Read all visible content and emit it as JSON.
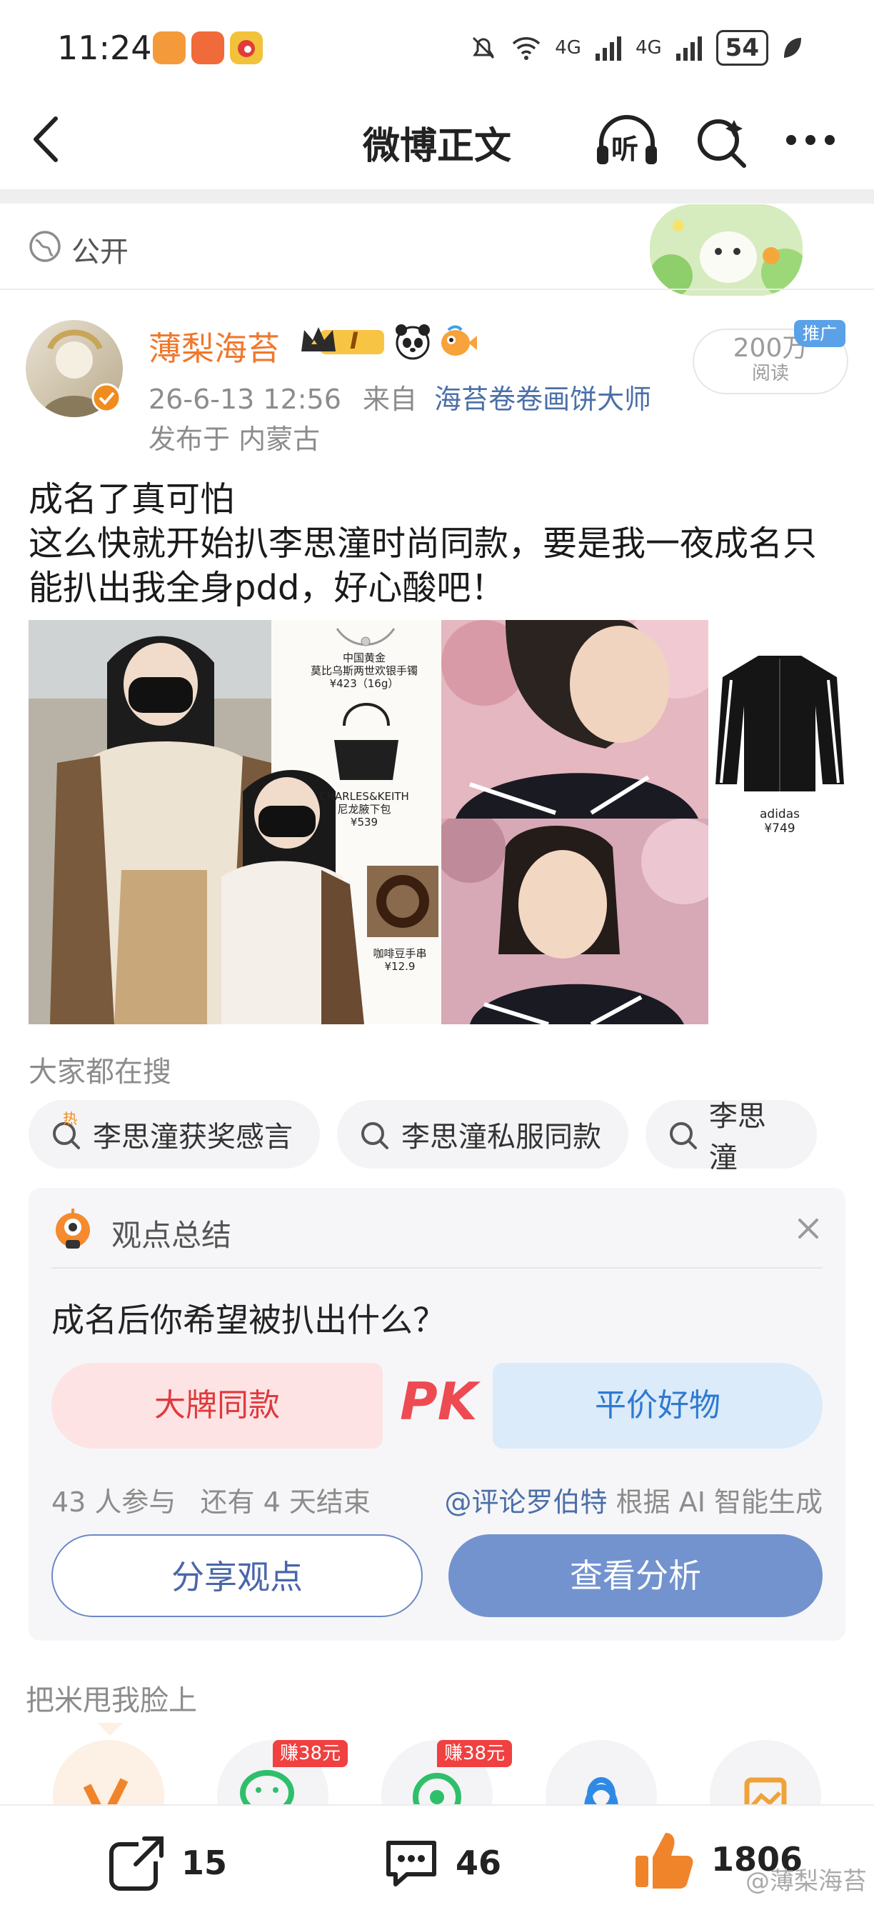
{
  "status_bar": {
    "time": "11:24",
    "network_1": "4G",
    "network_2": "4G",
    "battery": "54"
  },
  "nav": {
    "title": "微博正文",
    "listen_label": "听"
  },
  "visibility": {
    "label": "公开"
  },
  "post": {
    "author": "薄梨海苔",
    "vip_level": "I",
    "timestamp": "26-6-13 12:56",
    "from_label": "来自",
    "source": "海苔卷卷画饼大师",
    "location": "发布于 内蒙古",
    "reads": "200万",
    "reads_label": "阅读",
    "promo_badge": "推广",
    "text_line1": "成名了真可怕",
    "text_line2": "这么快就开始扒李思潼时尚同款，要是我一夜成名只能扒出我全身pdd，好心酸吧！"
  },
  "collage": {
    "items": [
      {
        "name": "中国黄金",
        "desc": "莫比乌斯两世欢银手镯",
        "price": "¥423（16g）"
      },
      {
        "name": "CHARLES&KEITH",
        "desc": "尼龙腋下包",
        "price": "¥539"
      },
      {
        "name": "",
        "desc": "咖啡豆手串",
        "price": "¥12.9"
      },
      {
        "name": "adidas",
        "desc": "",
        "price": "¥749"
      }
    ]
  },
  "searches": {
    "title": "大家都在搜",
    "hot_badge": "热",
    "chips": [
      "李思潼获奖感言",
      "李思潼私服同款",
      "李思潼"
    ]
  },
  "opinion_card": {
    "title": "观点总结",
    "question": "成名后你希望被扒出什么？",
    "option_a": "大牌同款",
    "pk_label": "PK",
    "option_b": "平价好物",
    "participants": "43 人参与",
    "remaining": "还有 4 天结束",
    "credit_user": "@评论罗伯特",
    "credit_text": "根据 AI 智能生成",
    "share_button": "分享观点",
    "view_button": "查看分析"
  },
  "share_section": {
    "title": "把米甩我脸上",
    "earn_badge_1": "赚38元",
    "earn_badge_2": "赚38元"
  },
  "bottom_bar": {
    "reposts": "15",
    "comments": "46",
    "likes": "1806"
  },
  "watermark": "@薄梨海苔",
  "colors": {
    "orange_name": "#f0782d",
    "link_blue": "#4b6fa8",
    "pk_red": "#e0393e",
    "pk_blue": "#2f7ad1",
    "view_button": "#7393cf"
  }
}
